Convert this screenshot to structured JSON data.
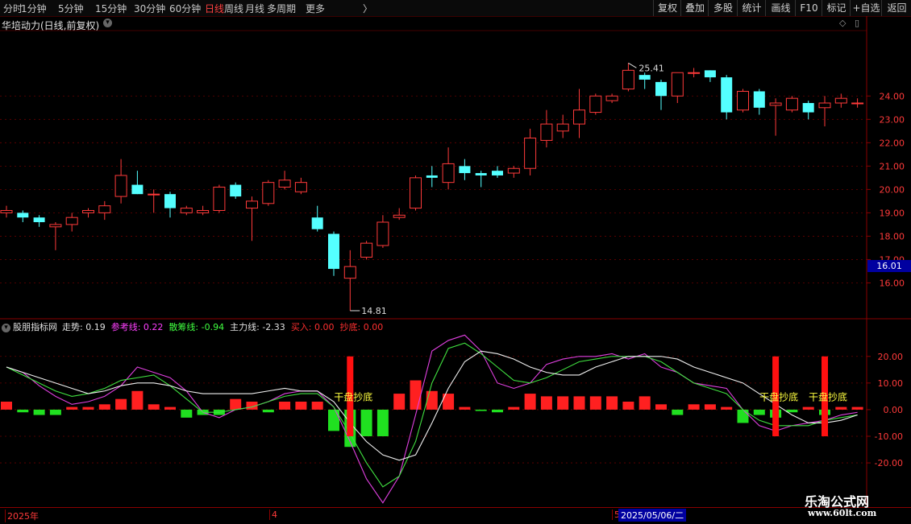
{
  "toolbar": {
    "left_items": [
      "分时",
      "1分钟",
      "5分钟",
      "15分钟",
      "30分钟",
      "60分钟",
      "日线",
      "周线",
      "月线",
      "多周期",
      "更多"
    ],
    "active_item": "日线",
    "more_arrow": "〉",
    "right_items": [
      "复权",
      "叠加",
      "多股",
      "统计",
      "画线",
      "F10",
      "标记",
      "+自选",
      "返回"
    ]
  },
  "main_panel": {
    "title": "华培动力(日线,前复权)",
    "high_label": "25.41",
    "low_label": "14.81",
    "current_price_label": "16.01",
    "y_ticks": [
      "24.00",
      "23.00",
      "22.00",
      "21.00",
      "20.00",
      "19.00",
      "18.00",
      "17.00",
      "16.00"
    ]
  },
  "indicator_panel": {
    "name": "股朋指标网",
    "items": [
      {
        "label": "走势:",
        "value": "0.19",
        "color": "#e0e0e0"
      },
      {
        "label": "参考线:",
        "value": "0.22",
        "color": "#ff40ff"
      },
      {
        "label": "散筹线:",
        "value": "-0.94",
        "color": "#40ff40"
      },
      {
        "label": "主力线:",
        "value": "-2.33",
        "color": "#e0e0e0"
      },
      {
        "label": "买入:",
        "value": "0.00",
        "color": "#ff3030"
      },
      {
        "label": "抄底:",
        "value": "0.00",
        "color": "#ff3030"
      }
    ],
    "signal_text": "干盘抄底",
    "y_ticks": [
      "20.00",
      "10.00",
      "0.00",
      "-10.00",
      "-20.00"
    ]
  },
  "timeline": {
    "labels": [
      "2025年",
      "4",
      "5"
    ],
    "cursor_date": "2025/05/06/二"
  },
  "colors": {
    "up": "#ff3a3a",
    "down": "#54ffff",
    "grid": "#6a0000",
    "frame": "#8a0000",
    "macd_up": "#ff2020",
    "macd_down": "#20e020",
    "line_white": "#f0f0f0",
    "line_magenta": "#e040e0",
    "line_green": "#40e040",
    "signal": "#ff1010",
    "signal_text": "#ffff40"
  },
  "watermark": {
    "title": "乐淘公式网",
    "url": "www.60lt.com"
  },
  "chart_data": {
    "type": "candlestick",
    "price_candles": [
      {
        "o": 19.0,
        "h": 19.3,
        "l": 18.8,
        "c": 19.1
      },
      {
        "o": 19.0,
        "h": 19.1,
        "l": 18.6,
        "c": 18.8
      },
      {
        "o": 18.8,
        "h": 18.9,
        "l": 18.4,
        "c": 18.6
      },
      {
        "o": 18.4,
        "h": 18.6,
        "l": 17.4,
        "c": 18.5
      },
      {
        "o": 18.5,
        "h": 19.0,
        "l": 18.2,
        "c": 18.8
      },
      {
        "o": 19.0,
        "h": 19.2,
        "l": 18.8,
        "c": 19.1
      },
      {
        "o": 19.0,
        "h": 19.5,
        "l": 18.7,
        "c": 19.3
      },
      {
        "o": 19.7,
        "h": 21.3,
        "l": 19.4,
        "c": 20.6
      },
      {
        "o": 20.2,
        "h": 20.8,
        "l": 19.8,
        "c": 19.8
      },
      {
        "o": 19.8,
        "h": 20.0,
        "l": 19.0,
        "c": 19.8
      },
      {
        "o": 19.8,
        "h": 19.9,
        "l": 18.8,
        "c": 19.2
      },
      {
        "o": 19.0,
        "h": 19.3,
        "l": 18.9,
        "c": 19.2
      },
      {
        "o": 19.0,
        "h": 19.3,
        "l": 18.9,
        "c": 19.1
      },
      {
        "o": 19.1,
        "h": 20.2,
        "l": 19.0,
        "c": 20.1
      },
      {
        "o": 20.2,
        "h": 20.3,
        "l": 19.6,
        "c": 19.7
      },
      {
        "o": 19.2,
        "h": 19.7,
        "l": 17.8,
        "c": 19.5
      },
      {
        "o": 19.4,
        "h": 20.4,
        "l": 19.3,
        "c": 20.3
      },
      {
        "o": 20.1,
        "h": 20.8,
        "l": 20.0,
        "c": 20.4
      },
      {
        "o": 19.9,
        "h": 20.5,
        "l": 19.8,
        "c": 20.3
      },
      {
        "o": 18.8,
        "h": 19.3,
        "l": 18.2,
        "c": 18.3
      },
      {
        "o": 18.1,
        "h": 18.2,
        "l": 16.3,
        "c": 16.6
      },
      {
        "o": 16.2,
        "h": 17.4,
        "l": 14.81,
        "c": 16.7
      },
      {
        "o": 17.1,
        "h": 17.8,
        "l": 17.0,
        "c": 17.7
      },
      {
        "o": 17.6,
        "h": 18.9,
        "l": 17.5,
        "c": 18.6
      },
      {
        "o": 18.8,
        "h": 19.2,
        "l": 18.7,
        "c": 18.9
      },
      {
        "o": 19.2,
        "h": 20.6,
        "l": 19.1,
        "c": 20.5
      },
      {
        "o": 20.6,
        "h": 21.0,
        "l": 20.1,
        "c": 20.5
      },
      {
        "o": 20.3,
        "h": 21.8,
        "l": 20.0,
        "c": 21.1
      },
      {
        "o": 21.0,
        "h": 21.3,
        "l": 20.4,
        "c": 20.7
      },
      {
        "o": 20.7,
        "h": 20.8,
        "l": 20.1,
        "c": 20.6
      },
      {
        "o": 20.8,
        "h": 21.0,
        "l": 20.5,
        "c": 20.6
      },
      {
        "o": 20.7,
        "h": 21.0,
        "l": 20.5,
        "c": 20.9
      },
      {
        "o": 20.9,
        "h": 22.6,
        "l": 20.6,
        "c": 22.2
      },
      {
        "o": 22.1,
        "h": 23.4,
        "l": 21.8,
        "c": 22.8
      },
      {
        "o": 22.5,
        "h": 23.2,
        "l": 22.2,
        "c": 22.8
      },
      {
        "o": 22.8,
        "h": 24.3,
        "l": 22.2,
        "c": 23.4
      },
      {
        "o": 23.3,
        "h": 24.1,
        "l": 23.2,
        "c": 24.0
      },
      {
        "o": 23.8,
        "h": 24.1,
        "l": 23.7,
        "c": 24.0
      },
      {
        "o": 24.3,
        "h": 25.41,
        "l": 24.2,
        "c": 25.1
      },
      {
        "o": 24.9,
        "h": 25.0,
        "l": 24.3,
        "c": 24.7
      },
      {
        "o": 24.6,
        "h": 24.7,
        "l": 23.4,
        "c": 24.0
      },
      {
        "o": 24.0,
        "h": 25.0,
        "l": 23.7,
        "c": 25.0
      },
      {
        "o": 25.0,
        "h": 25.2,
        "l": 24.8,
        "c": 25.0
      },
      {
        "o": 25.1,
        "h": 25.1,
        "l": 24.6,
        "c": 24.8
      },
      {
        "o": 24.8,
        "h": 24.9,
        "l": 23.0,
        "c": 23.3
      },
      {
        "o": 23.4,
        "h": 24.3,
        "l": 23.3,
        "c": 24.2
      },
      {
        "o": 24.2,
        "h": 24.3,
        "l": 23.2,
        "c": 23.5
      },
      {
        "o": 23.6,
        "h": 23.9,
        "l": 22.3,
        "c": 23.7
      },
      {
        "o": 23.4,
        "h": 24.0,
        "l": 23.3,
        "c": 23.9
      },
      {
        "o": 23.7,
        "h": 23.8,
        "l": 23.0,
        "c": 23.3
      },
      {
        "o": 23.5,
        "h": 24.0,
        "l": 22.7,
        "c": 23.7
      },
      {
        "o": 23.7,
        "h": 24.1,
        "l": 23.5,
        "c": 23.9
      },
      {
        "o": 23.7,
        "h": 23.9,
        "l": 23.5,
        "c": 23.7
      }
    ],
    "histogram": [
      3,
      -1,
      -2,
      -2,
      1,
      1,
      2,
      4,
      7,
      2,
      1,
      -3,
      -2,
      -2,
      4,
      3,
      -1,
      3,
      3,
      3,
      -8,
      -14,
      -10,
      -10,
      6,
      11,
      7,
      6,
      1,
      -0.5,
      -1,
      1,
      6,
      5,
      5,
      5,
      5,
      5,
      3,
      5,
      2,
      -2,
      2,
      2,
      1,
      -5,
      -2,
      -3,
      -1,
      1,
      -2,
      1,
      1
    ],
    "line_white": [
      16,
      14,
      12,
      10,
      8,
      6,
      7,
      9,
      10,
      10,
      9,
      7,
      6,
      6,
      6,
      6,
      7,
      8,
      7,
      7,
      3,
      -5,
      -12,
      -17,
      -19,
      -17,
      -5,
      8,
      18,
      22,
      21,
      19,
      16,
      14,
      13,
      13,
      16,
      18,
      20,
      20,
      20,
      19,
      16,
      14,
      12,
      10,
      6,
      2,
      -2,
      -5,
      -5,
      -4,
      -2
    ],
    "line_magenta": [
      16,
      14,
      9,
      5,
      2,
      3,
      5,
      9,
      16,
      14,
      12,
      7,
      -1,
      -3,
      0,
      1,
      3,
      6,
      7,
      7,
      1,
      -12,
      -26,
      -35,
      -25,
      -2,
      22,
      26,
      28,
      22,
      10,
      8,
      10,
      17,
      19,
      20,
      20,
      21,
      19,
      21,
      16,
      14,
      10,
      9,
      8,
      0,
      -6,
      -8,
      -6,
      -5,
      -4,
      -2,
      -1
    ],
    "line_green": [
      16,
      13,
      10,
      7,
      5,
      6,
      8,
      11,
      12,
      13,
      9,
      4,
      -1,
      -1,
      0,
      1,
      3,
      5,
      6,
      6,
      1,
      -9,
      -20,
      -29,
      -25,
      -12,
      10,
      23,
      25,
      21,
      16,
      11,
      10,
      12,
      15,
      18,
      19,
      20,
      20,
      20,
      18,
      14,
      10,
      8,
      6,
      0,
      -4,
      -6,
      -6,
      -6,
      -4,
      -3,
      -2
    ],
    "signals": [
      {
        "index": 21,
        "top": 20,
        "bottom": -10
      },
      {
        "index": 47,
        "top": 20,
        "bottom": -10
      },
      {
        "index": 50,
        "top": 20,
        "bottom": -10
      }
    ],
    "price_ylim": [
      14.5,
      26.8
    ],
    "indicator_ylim": [
      -36,
      29
    ]
  }
}
